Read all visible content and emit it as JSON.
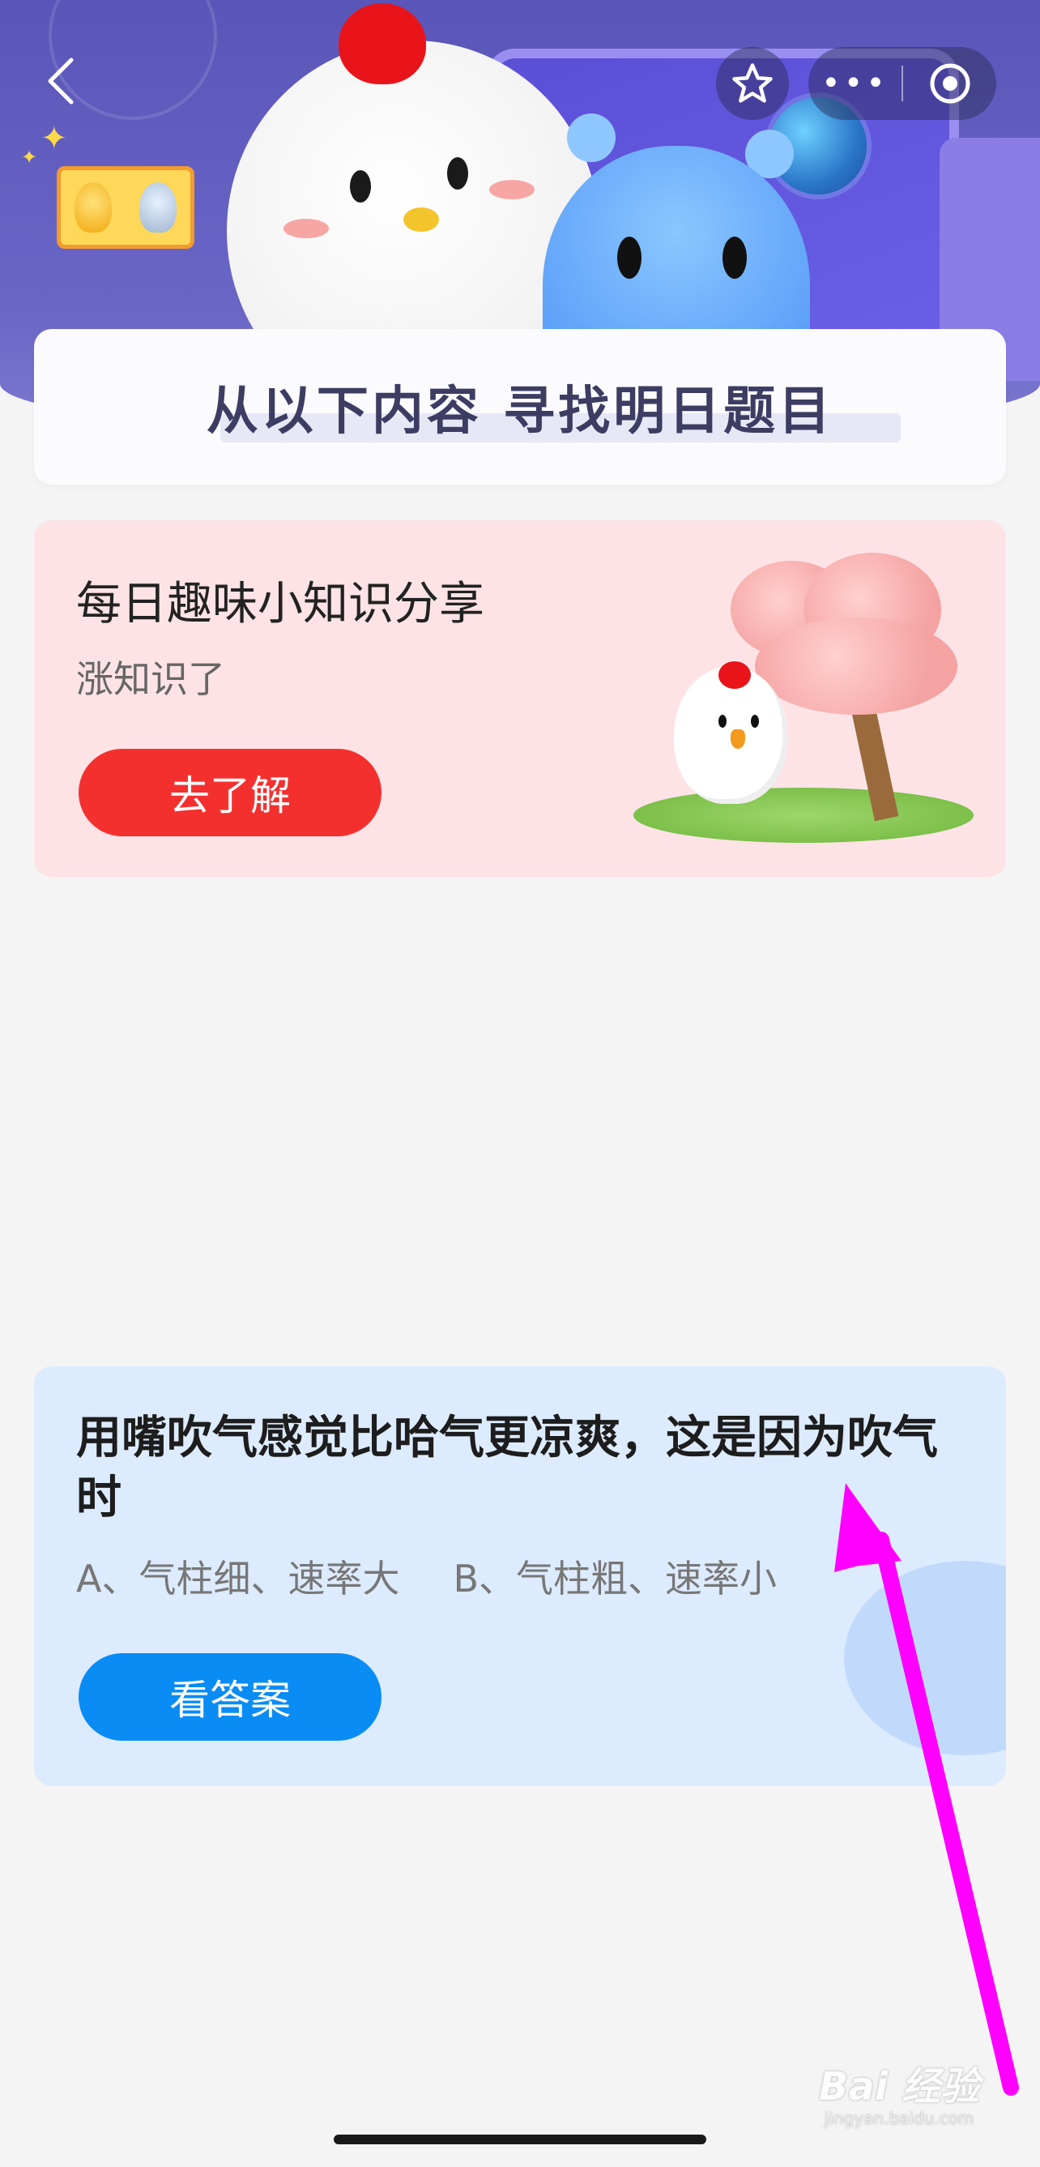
{
  "header": {
    "back_icon": "chevron-left-icon",
    "favorite_icon": "star-icon",
    "more_label": "•••",
    "target_icon": "record-target-icon",
    "title_banner": "从以下内容  寻找明日题目"
  },
  "knowledge_card": {
    "title": "每日趣味小知识分享",
    "subtitle": "涨知识了",
    "button_label": "去了解",
    "accent_color": "#f4302f",
    "background_color": "#fde3e5"
  },
  "question_card": {
    "question": "用嘴吹气感觉比哈气更凉爽，这是因为吹气时",
    "options": [
      "A、气柱细、速率大",
      "B、气柱粗、速率小"
    ],
    "button_label": "看答案",
    "accent_color": "#0a8cf5",
    "background_color": "#ddebff"
  },
  "annotation": {
    "arrow_color": "#ff00ff"
  },
  "watermark": {
    "brand": "Bai 经验",
    "domain": "jingyan.baidu.com"
  }
}
